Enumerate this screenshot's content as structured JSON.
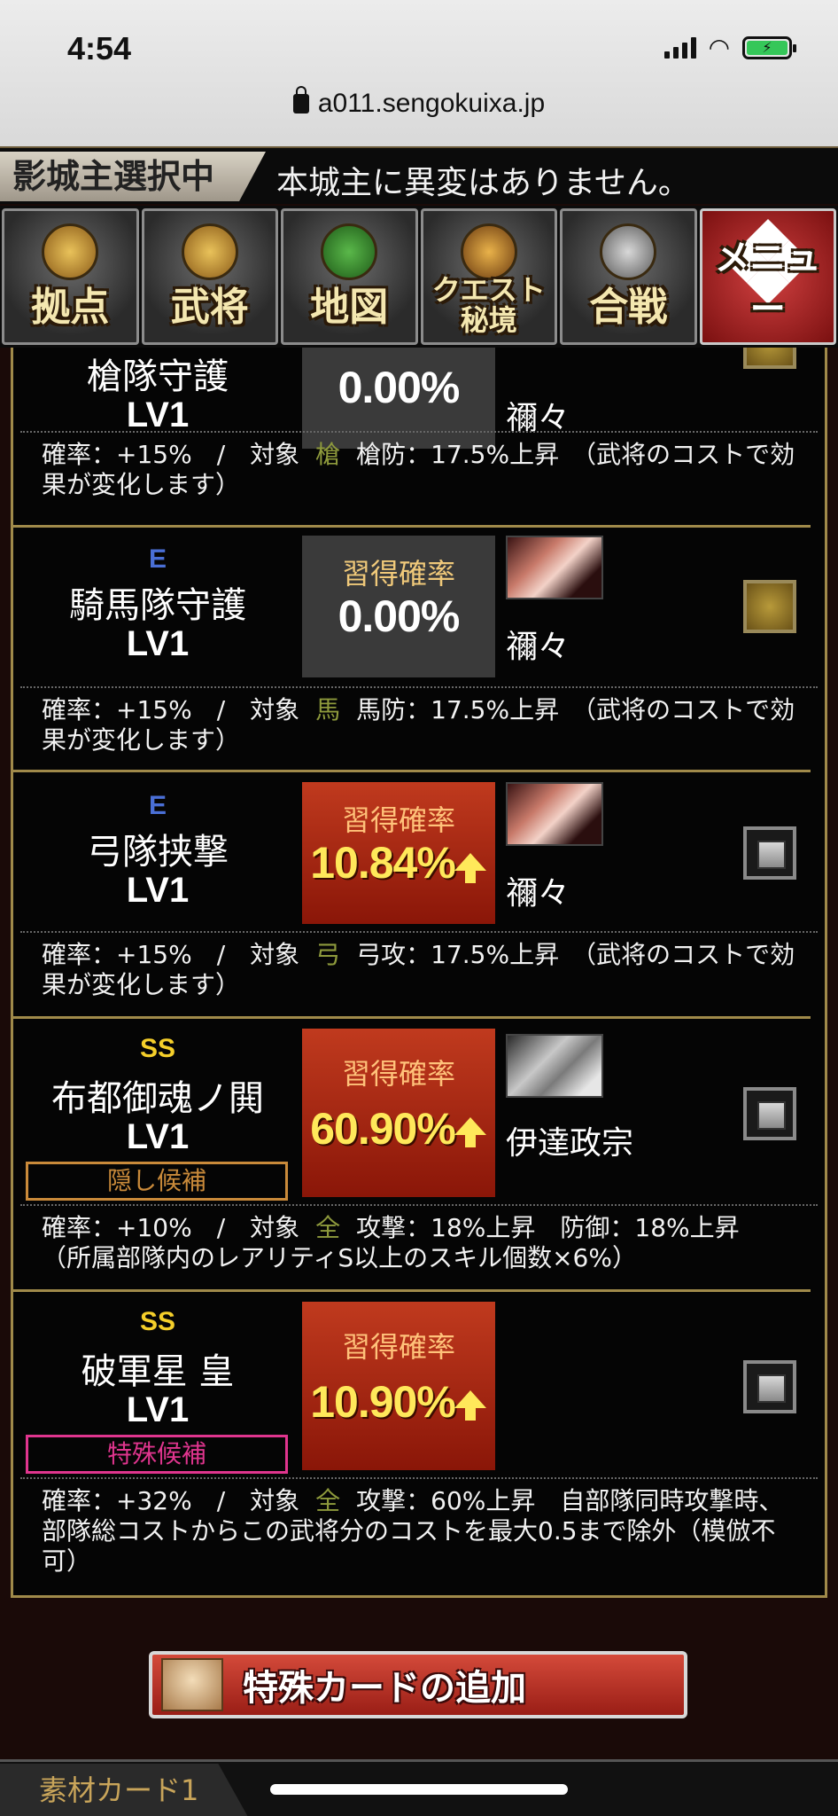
{
  "status": {
    "time": "4:54",
    "url": "a011.sengokuixa.jp"
  },
  "banner": {
    "tag": "影城主選択中",
    "message": "本城主に異変はありません。"
  },
  "nav": [
    {
      "label": "拠点",
      "icon": "base-icon"
    },
    {
      "label": "武将",
      "icon": "general-icon"
    },
    {
      "label": "地図",
      "icon": "map-icon"
    },
    {
      "label": "クエスト秘境",
      "icon": "quest-icon"
    },
    {
      "label": "合戦",
      "icon": "battle-icon"
    },
    {
      "label": "メニュー",
      "icon": "menu-icon"
    }
  ],
  "rate_label": "習得確率",
  "skills": [
    {
      "rank": "",
      "name": "槍隊守護",
      "level": "LV1",
      "rate": "0.00%",
      "rate_style": "gray",
      "owner": "禰々",
      "checkbox": "gold",
      "desc_prefix": "確率：+15%　/　対象",
      "desc_target": "槍",
      "desc_suffix": "槍防：17.5%上昇　（武将のコストで効果が変化します）"
    },
    {
      "rank": "E",
      "name": "騎馬隊守護",
      "level": "LV1",
      "rate": "0.00%",
      "rate_style": "gray",
      "owner": "禰々",
      "checkbox": "gold",
      "desc_prefix": "確率：+15%　/　対象",
      "desc_target": "馬",
      "desc_suffix": "馬防：17.5%上昇　（武将のコストで効果が変化します）"
    },
    {
      "rank": "E",
      "name": "弓隊挟撃",
      "level": "LV1",
      "rate": "10.84%",
      "rate_style": "red",
      "owner": "禰々",
      "checkbox": "gray",
      "desc_prefix": "確率：+15%　/　対象",
      "desc_target": "弓",
      "desc_suffix": "弓攻：17.5%上昇　（武将のコストで効果が変化します）"
    },
    {
      "rank": "SS",
      "name": "布都御魂ノ閧",
      "level": "LV1",
      "candidate": "隠し候補",
      "rate": "60.90%",
      "rate_style": "red",
      "owner": "伊達政宗",
      "checkbox": "gray",
      "desc_prefix": "確率：+10%　/　対象",
      "desc_target": "全",
      "desc_suffix": "攻撃：18%上昇　防御：18%上昇　（所属部隊内のレアリティS以上のスキル個数×6%）"
    },
    {
      "rank": "SS",
      "name": "破軍星 皇",
      "level": "LV1",
      "candidate": "特殊候補",
      "rate": "10.90%",
      "rate_style": "red",
      "owner": "",
      "checkbox": "gray",
      "desc_prefix": "確率：+32%　/　対象",
      "desc_target": "全",
      "desc_suffix": "攻撃：60%上昇　自部隊同時攻撃時、部隊総コストからこの武将分のコストを最大0.5まで除外（模倣不可）"
    }
  ],
  "add_card_label": "特殊カードの追加",
  "bottom_tab": "素材カード1"
}
